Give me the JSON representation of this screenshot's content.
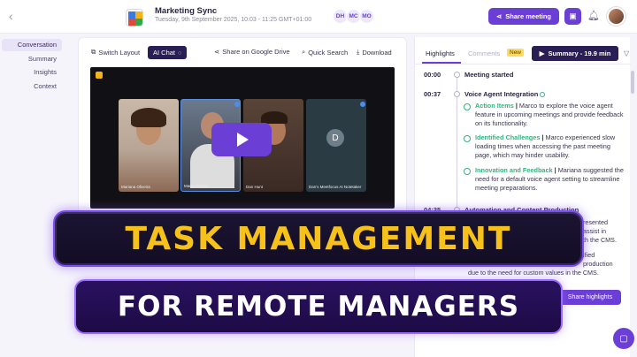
{
  "header": {
    "meeting_title": "Marketing Sync",
    "meeting_date": "Tuesday, 9th September 2025, 10:03 - 11:25 GMT+01:00",
    "participants": [
      "DH",
      "MC",
      "MO"
    ],
    "share_meeting_label": "Share meeting"
  },
  "sidebar": {
    "items": [
      {
        "label": "Conversation",
        "active": true
      },
      {
        "label": "Summary"
      },
      {
        "label": "Insights"
      },
      {
        "label": "Context"
      }
    ]
  },
  "toolbar": {
    "switch_layout": "Switch Layout",
    "ai_chat": "AI Chat",
    "share_drive": "Share on Google Drive",
    "quick_search": "Quick Search",
    "download": "Download"
  },
  "video": {
    "tiles": [
      {
        "label": "Mariana Oliveira"
      },
      {
        "label": "Marco Cerina"
      },
      {
        "label": "Dan Hunt"
      },
      {
        "label": "Dan's Meetfocus AI Notetaker",
        "initial": "D"
      }
    ]
  },
  "right_panel": {
    "tabs": {
      "highlights": "Highlights",
      "comments": "Comments",
      "new_badge": "New"
    },
    "summary_button": "Summary - 19.9 min",
    "timeline": [
      {
        "time": "00:00",
        "title": "Meeting started"
      },
      {
        "time": "00:37",
        "title": "Voice Agent Integration"
      },
      {
        "time": "04:35",
        "title": "Automation and Content Production"
      }
    ],
    "highlights": [
      {
        "label": "Action Items",
        "text": "Marco to explore the voice agent feature in upcoming meetings and provide feedback on its functionality."
      },
      {
        "label": "Identified Challenges",
        "text": "Marco experienced slow loading times when accessing the past meeting page, which may hinder usability."
      },
      {
        "label": "Innovation and Feedback",
        "text": "Mariana suggested the need for a default voice agent setting to streamline meeting preparations."
      }
    ],
    "faint_lines": [
      "resented",
      "assist in",
      "th the CMS.",
      "ified",
      "production",
      "due to the need for custom values in the CMS."
    ],
    "share_highlights": "Share highlights"
  },
  "overlay": {
    "headline": "TASK MANAGEMENT",
    "subheadline": "FOR REMOTE MANAGERS"
  },
  "colors": {
    "accent": "#6b3fd6",
    "dark": "#2a1f55",
    "highlight_green": "#36b37e",
    "headline_yellow": "#f6c11a"
  }
}
